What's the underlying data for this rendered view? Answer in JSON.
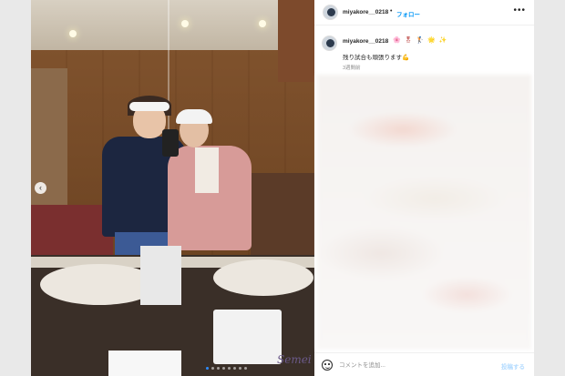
{
  "header": {
    "username": "miyakore__0218",
    "separator": "•",
    "follow_label": "フォロー",
    "more_icon": "more-horizontal-icon",
    "more_glyph": "•••"
  },
  "caption": {
    "username": "miyakore__0218",
    "emojis": "🌸 🎖 🏌 🌟 ✨",
    "text": "残り試合も頑張ります💪",
    "time_ago": "3週間前"
  },
  "photo": {
    "watermark": "Semei",
    "prev_icon": "chevron-left-icon",
    "prev_glyph": "‹",
    "carousel_dots": 8,
    "active_dot": 0
  },
  "footer": {
    "emoji_icon": "smile-icon",
    "comment_placeholder": "コメントを追加...",
    "post_label": "投稿する"
  },
  "colors": {
    "accent": "#0095f6",
    "post_disabled": "#b3dbff",
    "background": "#e9e9e9"
  }
}
